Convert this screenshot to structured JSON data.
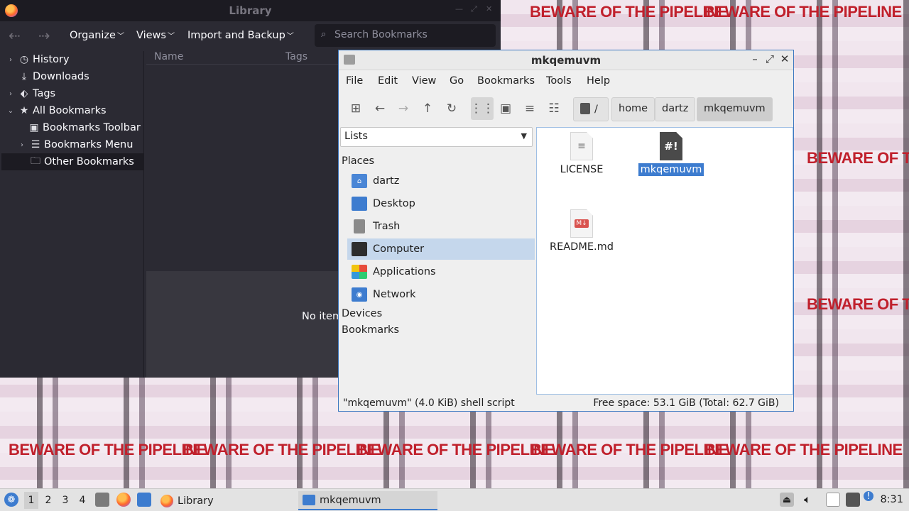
{
  "wallpaper": {
    "slogan": "BEWARE OF THE PIPELINE"
  },
  "library": {
    "title": "Library",
    "toolbar": {
      "organize": "Organize",
      "views": "Views",
      "import_backup": "Import and Backup",
      "search_placeholder": "Search Bookmarks"
    },
    "tree": {
      "history": "History",
      "downloads": "Downloads",
      "tags": "Tags",
      "all_bookmarks": "All Bookmarks",
      "bookmarks_toolbar": "Bookmarks Toolbar",
      "bookmarks_menu": "Bookmarks Menu",
      "other_bookmarks": "Other Bookmarks"
    },
    "columns": {
      "name": "Name",
      "tags": "Tags"
    },
    "empty_text": "No item"
  },
  "filemanager": {
    "title": "mkqemuvm",
    "menu": [
      "File",
      "Edit",
      "View",
      "Go",
      "Bookmarks",
      "Tools",
      "Help"
    ],
    "breadcrumb": {
      "root": "/",
      "home": "home",
      "user": "dartz",
      "current": "mkqemuvm"
    },
    "side_mode": "Lists",
    "sections": {
      "places": "Places",
      "devices": "Devices",
      "bookmarks": "Bookmarks"
    },
    "places": {
      "dartz": "dartz",
      "desktop": "Desktop",
      "trash": "Trash",
      "computer": "Computer",
      "applications": "Applications",
      "network": "Network"
    },
    "files": {
      "license": "LICENSE",
      "mkqemuvm": "mkqemuvm",
      "readme": "README.md"
    },
    "status": {
      "selection": "\"mkqemuvm\" (4.0 KiB) shell script",
      "free_space": "Free space: 53.1 GiB (Total: 62.7 GiB)"
    },
    "accent_color": "#3d7ccf"
  },
  "taskbar": {
    "workspaces": [
      "1",
      "2",
      "3",
      "4"
    ],
    "tasks": {
      "library": "Library",
      "mkqemuvm": "mkqemuvm"
    },
    "clock": "8:31"
  }
}
